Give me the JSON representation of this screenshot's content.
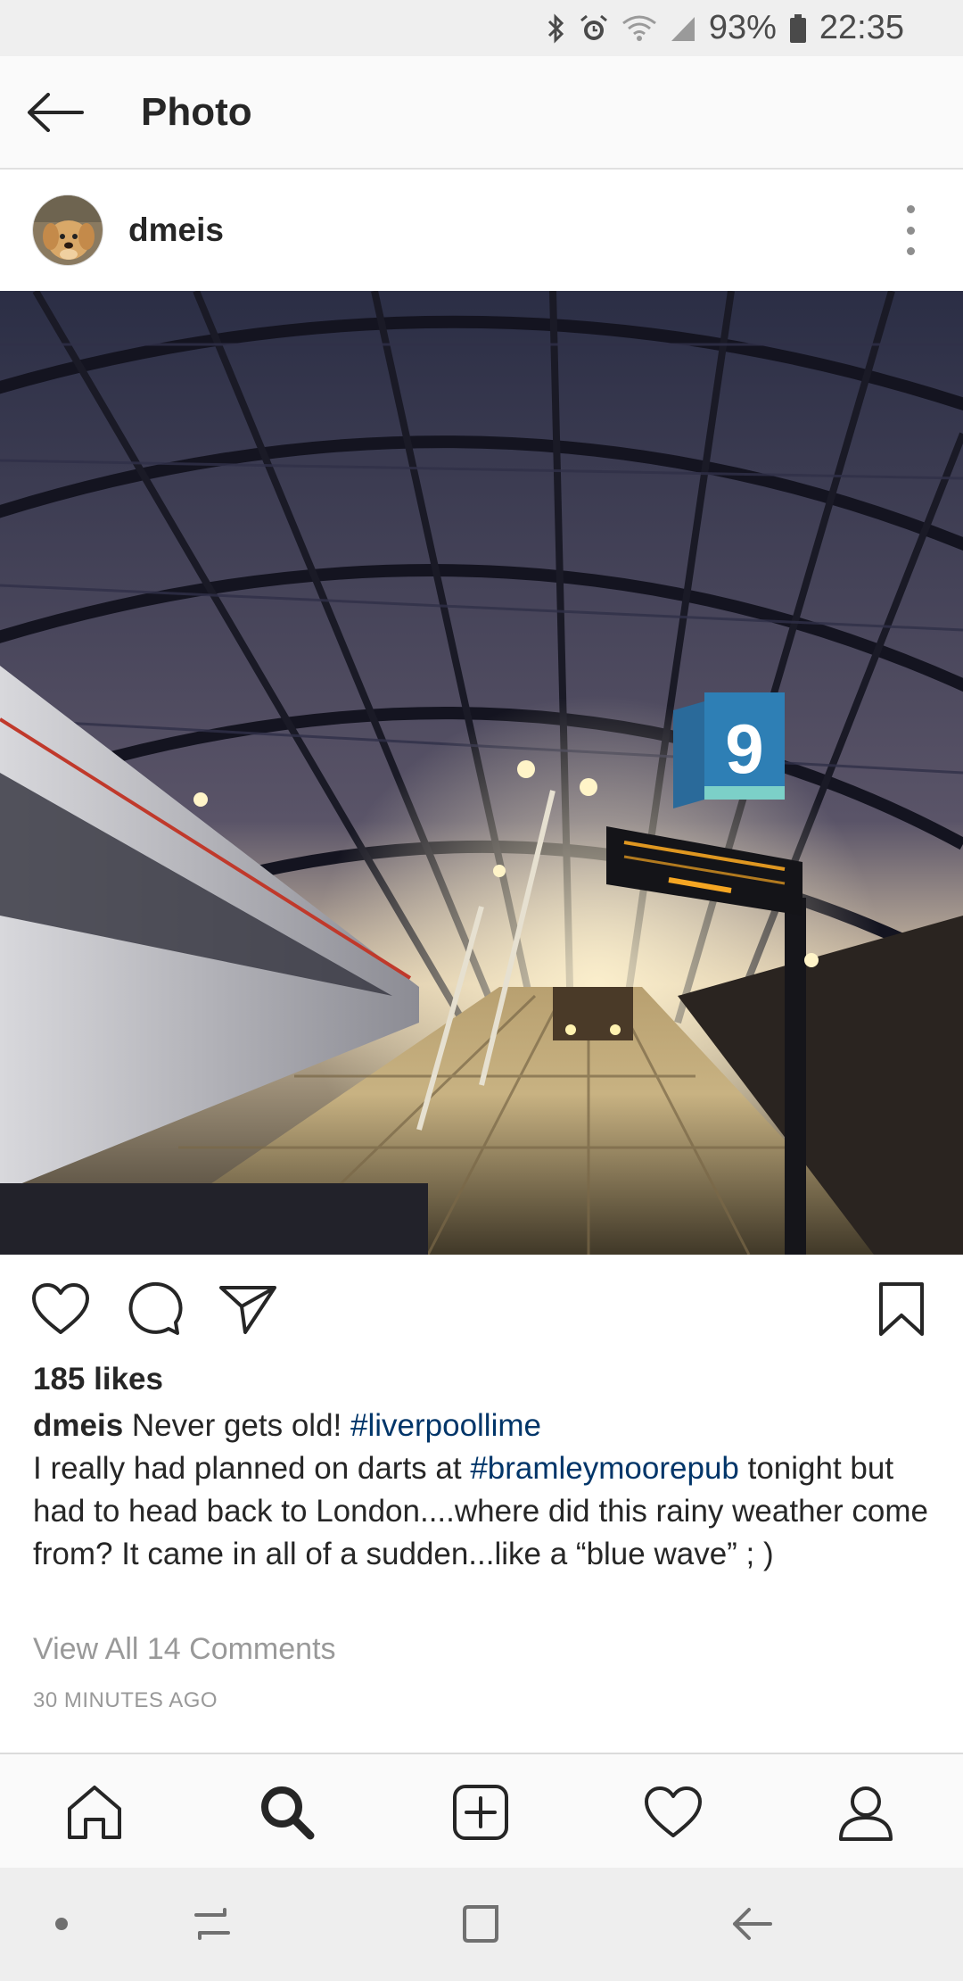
{
  "status_bar": {
    "battery": "93%",
    "time": "22:35",
    "icons": [
      "bluetooth-icon",
      "alarm-icon",
      "wifi-icon",
      "signal-icon",
      "battery-icon"
    ]
  },
  "header": {
    "title": "Photo",
    "back_icon": "arrow-left-icon"
  },
  "post": {
    "username": "dmeis",
    "avatar": "dog-avatar",
    "image_alt": "Train station platform 9 with arched steel roof",
    "platform_number": "9",
    "likes": "185 likes",
    "caption": {
      "username": "dmeis",
      "text_1": " Never gets old! ",
      "hashtag_1": "#liverpoollime",
      "text_2": "I really had planned on darts at ",
      "hashtag_2": "#bramleymoorepub",
      "text_3": " tonight but had to head back to London....where did this rainy weather come from?  It came in all of a sudden...like a “blue wave” ; )"
    },
    "view_comments": "View All 14 Comments",
    "timestamp": "30 MINUTES AGO"
  },
  "actions": [
    "heart-icon",
    "comment-icon",
    "share-icon",
    "bookmark-icon"
  ],
  "bottom_nav": [
    "home-icon",
    "search-icon",
    "add-post-icon",
    "activity-heart-icon",
    "profile-icon"
  ],
  "system_nav": [
    "dot-icon",
    "recent-apps-icon",
    "home-square-icon",
    "back-arrow-icon"
  ],
  "colors": {
    "hashtag": "#003569",
    "muted": "#999999",
    "text": "#262626"
  }
}
